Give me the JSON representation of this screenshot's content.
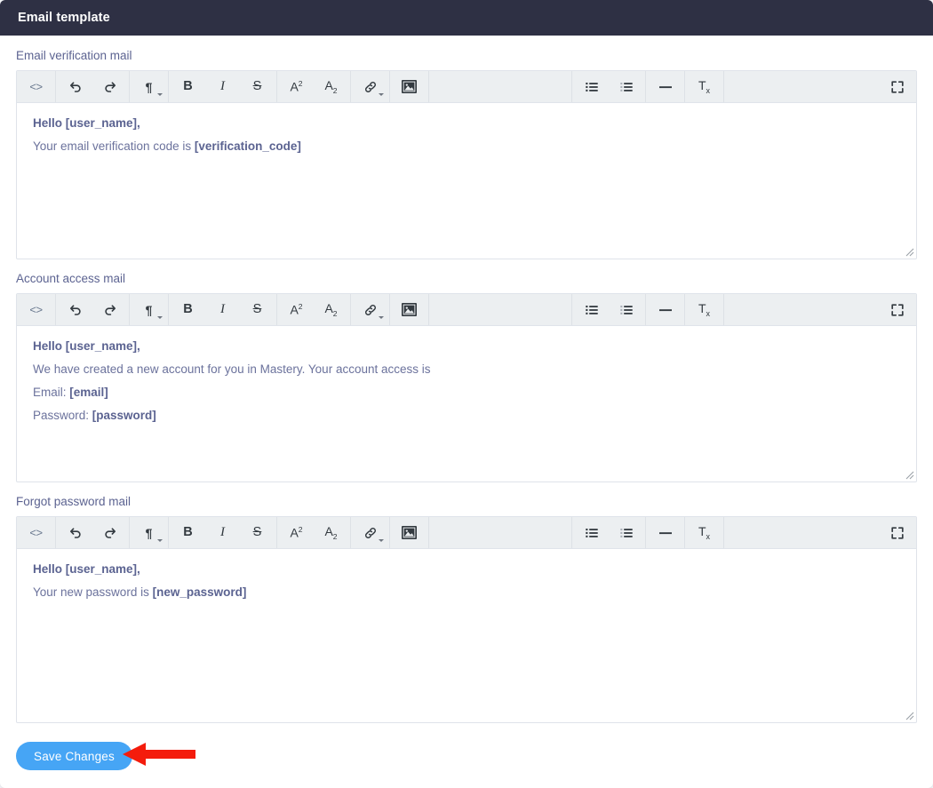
{
  "header": {
    "title": "Email template"
  },
  "toolbar": {
    "groups": [
      {
        "buttons": [
          {
            "name": "source-code-icon",
            "glyph": "<>",
            "kind": "code"
          }
        ]
      },
      {
        "buttons": [
          {
            "name": "undo-icon",
            "glyph": "undo",
            "kind": "svg"
          },
          {
            "name": "redo-icon",
            "glyph": "redo",
            "kind": "svg"
          }
        ]
      },
      {
        "buttons": [
          {
            "name": "paragraph-format-icon",
            "glyph": "¶",
            "kind": "pilcrow",
            "dropdown": true
          }
        ]
      },
      {
        "buttons": [
          {
            "name": "bold-icon",
            "glyph": "B",
            "kind": "bold"
          },
          {
            "name": "italic-icon",
            "glyph": "I",
            "kind": "ital"
          },
          {
            "name": "strikethrough-icon",
            "glyph": "S",
            "kind": "strike"
          }
        ]
      },
      {
        "buttons": [
          {
            "name": "superscript-icon",
            "glyph": "A2",
            "kind": "sup"
          },
          {
            "name": "subscript-icon",
            "glyph": "A2",
            "kind": "sub"
          }
        ]
      },
      {
        "buttons": [
          {
            "name": "insert-link-icon",
            "glyph": "link",
            "kind": "svg",
            "dropdown": true
          }
        ]
      },
      {
        "buttons": [
          {
            "name": "insert-image-icon",
            "glyph": "image",
            "kind": "svg"
          }
        ]
      },
      {
        "buttons": [
          {
            "name": "align-left-icon",
            "glyph": "align-left",
            "kind": "svg"
          },
          {
            "name": "align-center-icon",
            "glyph": "align-center",
            "kind": "svg"
          },
          {
            "name": "align-right-icon",
            "glyph": "align-right",
            "kind": "svg"
          },
          {
            "name": "align-justify-icon",
            "glyph": "align-justify",
            "kind": "svg"
          }
        ]
      },
      {
        "buttons": [
          {
            "name": "unordered-list-icon",
            "glyph": "ul",
            "kind": "svg"
          },
          {
            "name": "ordered-list-icon",
            "glyph": "ol",
            "kind": "svg"
          }
        ]
      },
      {
        "buttons": [
          {
            "name": "horizontal-rule-icon",
            "glyph": "hr",
            "kind": "svg"
          }
        ]
      },
      {
        "buttons": [
          {
            "name": "clear-formatting-icon",
            "glyph": "Tx",
            "kind": "tx"
          }
        ]
      },
      {
        "buttons": [
          {
            "name": "fullscreen-icon",
            "glyph": "fullscreen",
            "kind": "svg"
          }
        ]
      }
    ]
  },
  "editors": [
    {
      "label": "Email verification mail",
      "name": "email-verification-mail",
      "height": 175,
      "lines": [
        [
          {
            "text": "Hello [user_name],",
            "bold": true
          }
        ],
        [
          {
            "text": "Your email verification code is ",
            "bold": false
          },
          {
            "text": "[verification_code]",
            "bold": true
          }
        ]
      ]
    },
    {
      "label": "Account access mail",
      "name": "account-access-mail",
      "height": 175,
      "lines": [
        [
          {
            "text": "Hello [user_name],",
            "bold": true
          }
        ],
        [
          {
            "text": "We have created a new account for you in Mastery. Your account access is",
            "bold": false
          }
        ],
        [
          {
            "text": "Email: ",
            "bold": false
          },
          {
            "text": "[email]",
            "bold": true
          }
        ],
        [
          {
            "text": "Password: ",
            "bold": false
          },
          {
            "text": "[password]",
            "bold": true
          }
        ]
      ]
    },
    {
      "label": "Forgot password mail",
      "name": "forgot-password-mail",
      "height": 195,
      "lines": [
        [
          {
            "text": "Hello [user_name],",
            "bold": true
          }
        ],
        [
          {
            "text": "Your new password is ",
            "bold": false
          },
          {
            "text": "[new_password]",
            "bold": true
          }
        ]
      ]
    }
  ],
  "footer": {
    "save_label": "Save Changes",
    "annotation": {
      "name": "red-pointer-arrow",
      "color": "#f41c0c",
      "direction": "left"
    }
  },
  "colors": {
    "header_bg": "#2e3044",
    "accent_button": "#46a5f5",
    "label_text": "#5c6391",
    "body_text": "#6b729c",
    "toolbar_bg": "#eceff1",
    "annotation_red": "#f41c0c"
  }
}
